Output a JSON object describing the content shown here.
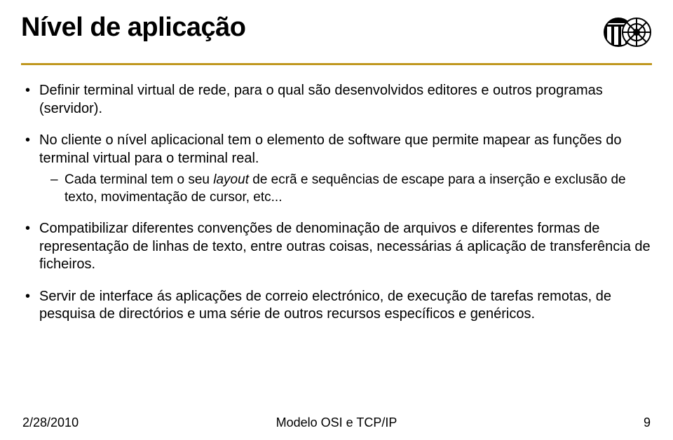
{
  "title": "Nível de aplicação",
  "bullets": [
    {
      "text": "Definir terminal virtual de rede, para o qual são desenvolvidos editores e outros programas (servidor)."
    },
    {
      "text": "No cliente o nível aplicacional tem o elemento de software que permite mapear as funções do terminal virtual para o terminal real.",
      "sub": [
        {
          "pre": "Cada terminal tem o seu ",
          "italic": "layout",
          "post": " de ecrã e sequências de escape para a inserção e exclusão de texto, movimentação de cursor, etc..."
        }
      ]
    },
    {
      "text": "Compatibilizar diferentes convenções de denominação de arquivos e diferentes formas de representação de linhas de texto, entre outras coisas, necessárias á aplicação de transferência de ficheiros."
    },
    {
      "text": "Servir de interface ás aplicações de correio electrónico, de execução de tarefas remotas, de pesquisa de directórios e uma série de outros recursos específicos e genéricos."
    }
  ],
  "footer": {
    "date": "2/28/2010",
    "center": "Modelo OSI e TCP/IP",
    "page": "9"
  },
  "logo_name": "institution-emblem"
}
